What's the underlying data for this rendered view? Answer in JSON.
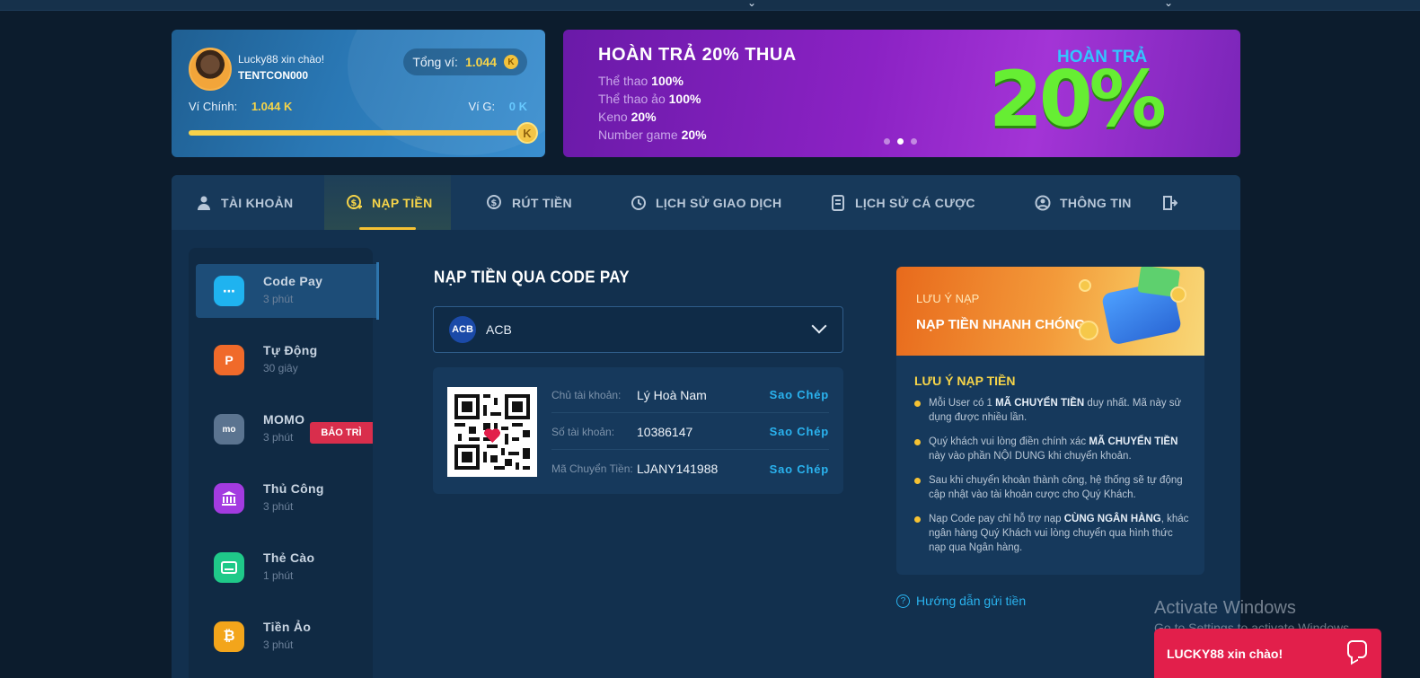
{
  "user": {
    "greeting": "Lucky88 xin chào!",
    "username": "TENTCON000",
    "total_label": "Tổng ví:",
    "total_value": "1.044",
    "main_wallet_label": "Ví Chính:",
    "main_wallet_value": "1.044 K",
    "g_wallet_label": "Ví G:",
    "g_wallet_value": "0 K",
    "coin_symbol": "K"
  },
  "banner": {
    "title": "HOÀN TRẢ 20% THUA",
    "lines": [
      {
        "label": "Thể thao",
        "value": "100%"
      },
      {
        "label": "Thể thao ảo",
        "value": "100%"
      },
      {
        "label": "Keno",
        "value": "20%"
      },
      {
        "label": "Number game",
        "value": "20%"
      }
    ],
    "badge_sub": "HOÀN TRẢ",
    "badge_big": "20%",
    "active_slide": 2,
    "slide_count": 3
  },
  "tabs": [
    {
      "label": "TÀI KHOẢN",
      "icon": "user-icon",
      "active": false
    },
    {
      "label": "NẠP TIỀN",
      "icon": "deposit-coin-icon",
      "active": true
    },
    {
      "label": "RÚT TIỀN",
      "icon": "withdraw-icon",
      "active": false
    },
    {
      "label": "LỊCH SỬ GIAO DỊCH",
      "icon": "history-icon",
      "active": false
    },
    {
      "label": "LỊCH SỬ CÁ CƯỢC",
      "icon": "bet-history-icon",
      "active": false
    },
    {
      "label": "THÔNG TIN",
      "icon": "profile-icon",
      "active": false
    },
    {
      "label": "",
      "icon": "logout-icon",
      "active": false
    }
  ],
  "methods": [
    {
      "name": "Code Pay",
      "time": "3 phút",
      "icon": "codepay-icon",
      "color": "#1fb3f0",
      "active": true
    },
    {
      "name": "Tự Động",
      "time": "30 giây",
      "icon": "auto-icon",
      "color": "#f06a2a",
      "active": false
    },
    {
      "name": "MOMO",
      "time": "3 phút",
      "icon": "momo-icon",
      "color": "#5b7490",
      "active": false,
      "badge": "BẢO TRÌ"
    },
    {
      "name": "Thủ Công",
      "time": "3 phút",
      "icon": "bank-icon",
      "color": "#a33be0",
      "active": false
    },
    {
      "name": "Thẻ Cào",
      "time": "1 phút",
      "icon": "card-icon",
      "color": "#1fc989",
      "active": false
    },
    {
      "name": "Tiền Ảo",
      "time": "3 phút",
      "icon": "bitcoin-icon",
      "color": "#f3a51b",
      "active": false
    }
  ],
  "deposit": {
    "title": "NẠP TIỀN QUA CODE PAY",
    "bank_logo_text": "ACB",
    "bank_name": "ACB",
    "rows": [
      {
        "label": "Chủ tài khoản:",
        "value": "Lý Hoà Nam",
        "action": "Sao Chép"
      },
      {
        "label": "Số tài khoản:",
        "value": "10386147",
        "action": "Sao Chép"
      },
      {
        "label": "Mã Chuyển Tiền:",
        "value": "LJANY141988",
        "action": "Sao Chép"
      }
    ]
  },
  "notice": {
    "head_small": "LƯU Ý NẠP",
    "head_big": "NẠP TIỀN NHANH CHÓNG",
    "title": "LƯU Ý NẠP TIỀN",
    "items": [
      {
        "pre": "Mỗi User có 1 ",
        "bold": "MÃ CHUYỂN TIỀN",
        "post": " duy nhất. Mã này sử dụng được nhiều lần."
      },
      {
        "pre": "Quý khách vui lòng điền chính xác ",
        "bold": "MÃ CHUYỂN TIỀN",
        "post": " này vào phần NỘI DUNG khi chuyển khoản."
      },
      {
        "pre": "Sau khi chuyển khoản thành công, hệ thống sẽ tự động cập nhật vào tài khoản cược cho Quý Khách.",
        "bold": "",
        "post": ""
      },
      {
        "pre": "Nạp Code pay chỉ hỗ trợ nạp ",
        "bold": "CÙNG NGÂN HÀNG",
        "post": ", khác ngân hàng Quý Khách vui lòng chuyển qua hình thức nạp qua Ngân hàng."
      }
    ],
    "guide_link": "Hướng dẫn gửi tiền"
  },
  "watermark": {
    "line1": "Activate Windows",
    "line2": "Go to Settings to activate Windows."
  },
  "chat": {
    "label": "LUCKY88 xin chào!"
  }
}
